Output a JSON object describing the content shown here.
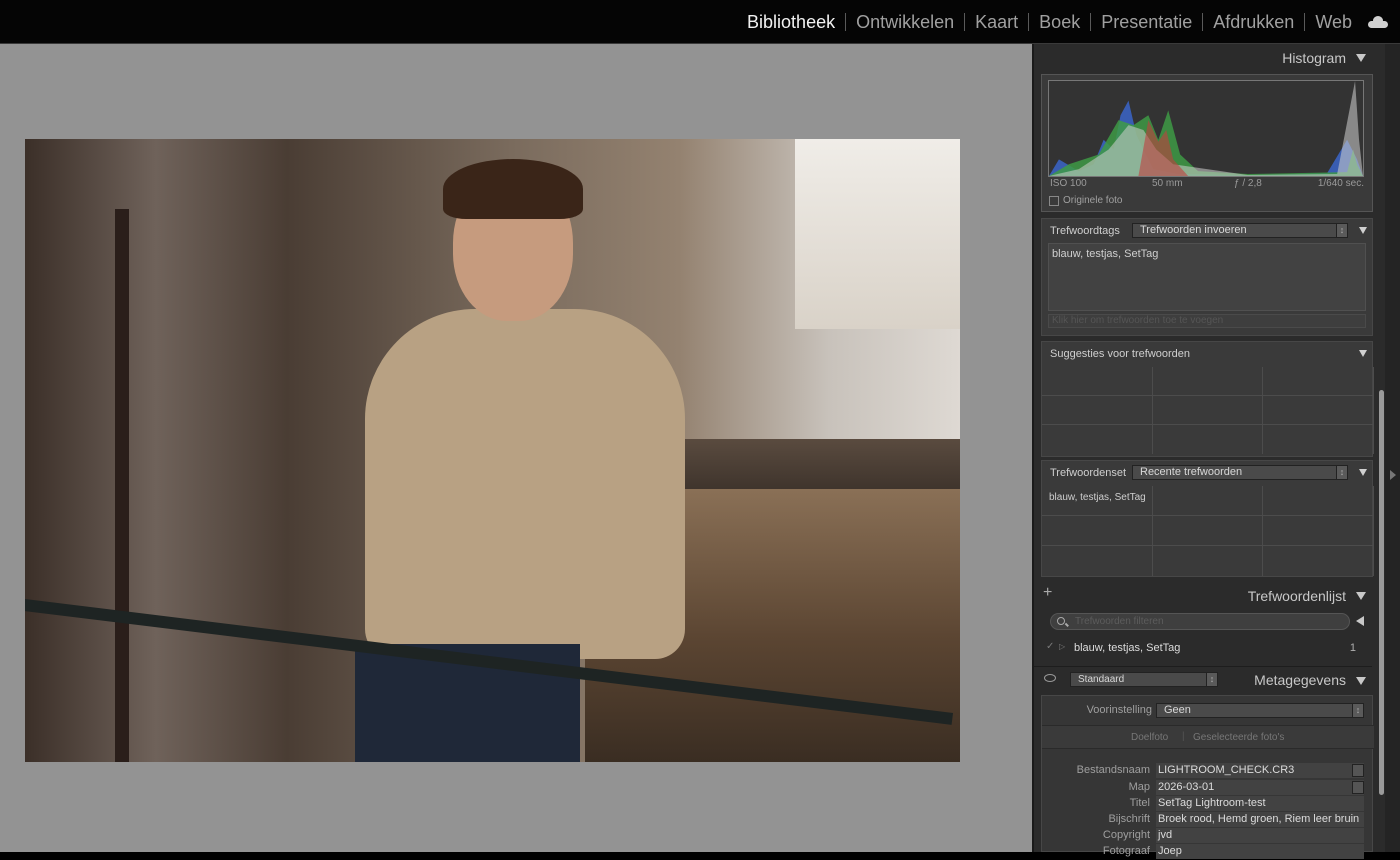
{
  "topbar": {
    "modules": [
      "Bibliotheek",
      "Ontwikkelen",
      "Kaart",
      "Boek",
      "Presentatie",
      "Afdrukken",
      "Web"
    ],
    "active_module": "Bibliotheek"
  },
  "histogram": {
    "title": "Histogram",
    "iso": "ISO 100",
    "focal": "50 mm",
    "aperture": "ƒ / 2,8",
    "shutter": "1/640 sec.",
    "original_photo": "Originele foto"
  },
  "keyword_tags": {
    "label": "Trefwoordtags",
    "mode": "Trefwoorden invoeren",
    "keywords": "blauw, testjas, SetTag",
    "add_placeholder": "Klik hier om trefwoorden toe te voegen"
  },
  "suggestions": {
    "label": "Suggesties voor trefwoorden"
  },
  "keyword_set": {
    "label": "Trefwoordenset",
    "set": "Recente trefwoorden",
    "items": [
      "blauw, testjas, SetTag",
      "",
      "",
      "",
      "",
      "",
      "",
      "",
      ""
    ]
  },
  "keyword_list": {
    "title": "Trefwoordenlijst",
    "filter_placeholder": "Trefwoorden filteren",
    "items": [
      {
        "name": "blauw, testjas, SetTag",
        "count": "1"
      }
    ]
  },
  "metadata": {
    "title": "Metagegevens",
    "preset_view": "Standaard",
    "preset_label": "Voorinstelling",
    "preset_value": "Geen",
    "target": "Doelfoto",
    "selected": "Geselecteerde foto's",
    "fields": [
      {
        "label": "Bestandsnaam",
        "value": "LIGHTROOM_CHECK.CR3"
      },
      {
        "label": "Map",
        "value": "2026-03-01"
      },
      {
        "label": "Titel",
        "value": "SetTag Lightroom-test"
      },
      {
        "label": "Bijschrift",
        "value": "Broek rood, Hemd groen, Riem leer bruin"
      },
      {
        "label": "Copyright",
        "value": "jvd"
      },
      {
        "label": "Fotograaf",
        "value": "Joep"
      }
    ]
  }
}
